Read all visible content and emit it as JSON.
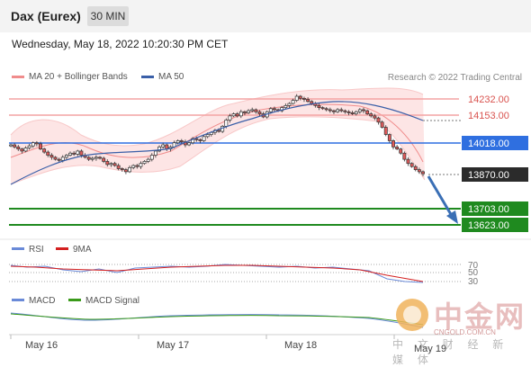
{
  "header": {
    "title": "Dax (Eurex)",
    "interval": "30 MIN"
  },
  "datetime": "Wednesday, May 18, 2022 10:20:30 PM CET",
  "legend": {
    "bollinger": "MA 20 + Bollinger Bands",
    "ma50": "MA 50"
  },
  "credit": "Research © 2022 Trading Central",
  "colors": {
    "candle_up": "#2f2f2f",
    "candle_down": "#e05b5b",
    "bollinger": "#f3a3a3",
    "ma50": "#3a5fa8",
    "resistance": "#f4a3a3",
    "pivot": "#2f6fe0",
    "support": "#1f8a1f",
    "current": "#2b2b2b",
    "arrow": "#3a6fb5",
    "rsi": "#6a8ad8",
    "rsi_ma": "#d42020",
    "macd": "#6a8ad8",
    "macd_signal": "#3a9a1a"
  },
  "levels": [
    {
      "value": "14232.00",
      "kind": "resistance"
    },
    {
      "value": "14153.00",
      "kind": "resistance"
    },
    {
      "value": "14018.00",
      "kind": "pivot"
    },
    {
      "value": "13870.00",
      "kind": "current"
    },
    {
      "value": "13703.00",
      "kind": "support"
    },
    {
      "value": "13623.00",
      "kind": "support"
    }
  ],
  "rsi_panel": {
    "legend_rsi": "RSI",
    "legend_ma": "9MA",
    "levels": [
      "70",
      "50",
      "30"
    ]
  },
  "macd_panel": {
    "legend_macd": "MACD",
    "legend_signal": "MACD Signal"
  },
  "x_axis": [
    "May 16",
    "May 17",
    "May 18",
    "May 19"
  ],
  "watermark": {
    "name": "中金网",
    "url": "CNGOLD.COM.CN",
    "tagline": "中 文 财 经 新 媒 体"
  },
  "chart_data": {
    "type": "candlestick",
    "instrument": "Dax (Eurex)",
    "timeframe": "30 MIN",
    "x_labels": [
      "May 16",
      "May 17",
      "May 18",
      "May 19"
    ],
    "price_levels": {
      "resistance": [
        14232.0,
        14153.0
      ],
      "pivot": 14018.0,
      "last": 13870.0,
      "support": [
        13703.0,
        13623.0
      ]
    },
    "closes": [
      14010,
      14000,
      13990,
      13980,
      13995,
      14005,
      14020,
      14015,
      13990,
      13975,
      13960,
      13950,
      13940,
      13935,
      13950,
      13960,
      13970,
      13965,
      13980,
      13960,
      13950,
      13940,
      13945,
      13950,
      13945,
      13930,
      13915,
      13920,
      13910,
      13895,
      13890,
      13880,
      13900,
      13910,
      13905,
      13920,
      13930,
      13940,
      13960,
      13980,
      14000,
      14010,
      13990,
      14000,
      14020,
      14030,
      14025,
      14010,
      14020,
      14040,
      14035,
      14030,
      14050,
      14060,
      14070,
      14080,
      14075,
      14100,
      14130,
      14150,
      14160,
      14150,
      14170,
      14165,
      14175,
      14180,
      14170,
      14160,
      14145,
      14170,
      14185,
      14180,
      14175,
      14190,
      14200,
      14210,
      14225,
      14245,
      14235,
      14230,
      14220,
      14210,
      14200,
      14190,
      14185,
      14180,
      14175,
      14170,
      14180,
      14175,
      14170,
      14165,
      14160,
      14170,
      14180,
      14175,
      14160,
      14150,
      14140,
      14120,
      14095,
      14060,
      14030,
      14000,
      13990,
      13970,
      13940,
      13920,
      13905,
      13890,
      13880,
      13870
    ],
    "ma50_y_range": [
      13850,
      14200
    ],
    "rsi_levels": [
      70,
      50,
      30
    ]
  }
}
